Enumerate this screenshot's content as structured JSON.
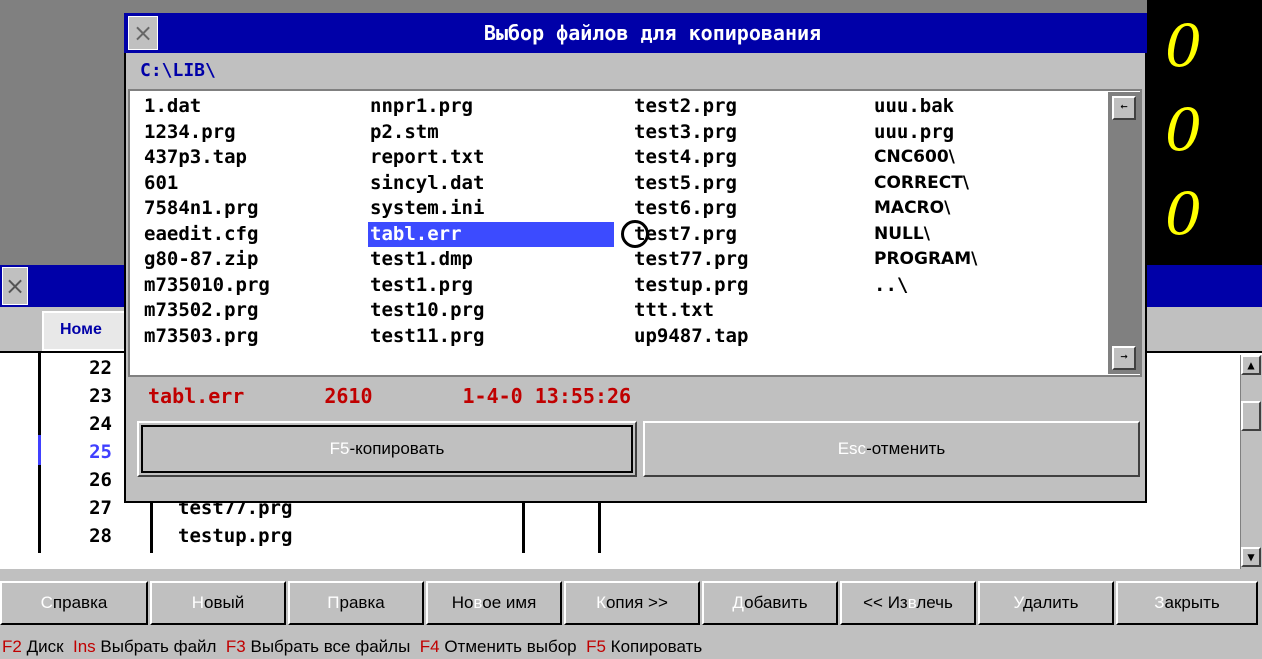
{
  "background": {
    "digits": [
      "0",
      "0",
      "0"
    ],
    "tab_label": "Номе",
    "rows": [
      {
        "num": "22",
        "name": ""
      },
      {
        "num": "23",
        "name": ""
      },
      {
        "num": "24",
        "name": ""
      },
      {
        "num": "25",
        "name": ""
      },
      {
        "num": "26",
        "name": ""
      },
      {
        "num": "27",
        "name": "test77.prg"
      },
      {
        "num": "28",
        "name": "testup.prg"
      }
    ]
  },
  "dialog": {
    "title": "Выбор файлов для копирования",
    "path": "C:\\LIB\\",
    "files": {
      "col1": [
        "1.dat",
        "1234.prg",
        "437p3.tap",
        "601",
        "7584n1.prg",
        "eaedit.cfg",
        "g80-87.zip",
        "m735010.prg",
        "m73502.prg",
        "m73503.prg"
      ],
      "col2": [
        "nnpr1.prg",
        "p2.stm",
        "report.txt",
        "sincyl.dat",
        "system.ini",
        "tabl.err",
        "test1.dmp",
        "test1.prg",
        "test10.prg",
        "test11.prg"
      ],
      "col3": [
        "test2.prg",
        "test3.prg",
        "test4.prg",
        "test5.prg",
        "test6.prg",
        "test7.prg",
        "test77.prg",
        "testup.prg",
        "ttt.txt",
        "up9487.tap"
      ],
      "col4": [
        "uuu.bak",
        "uuu.prg",
        "CNC600\\",
        "CORRECT\\",
        "MACRO\\",
        "NULL\\",
        "PROGRAM\\",
        "..\\"
      ]
    },
    "selected_file": "tabl.err",
    "info": {
      "name": "tabl.err",
      "size": "2610",
      "datetime": "1-4-0 13:55:26"
    },
    "buttons": {
      "copy_hotkey": "F5",
      "copy_label": "-копировать",
      "cancel_hotkey": "Esc",
      "cancel_label": "-отменить"
    }
  },
  "toolbar": [
    {
      "hk": "С",
      "rest": "правка"
    },
    {
      "hk": "Н",
      "rest": "овый"
    },
    {
      "hk": "П",
      "rest": "равка"
    },
    {
      "pre": "Но",
      "hk": "в",
      "rest": "ое имя"
    },
    {
      "hk": "К",
      "rest": "опия >>"
    },
    {
      "hk": "Д",
      "rest": "обавить"
    },
    {
      "pre": "<< Из",
      "hk": "в",
      "rest": "лечь"
    },
    {
      "hk": "У",
      "rest": "далить"
    },
    {
      "hk": "З",
      "rest": "акрыть"
    }
  ],
  "status_line": [
    {
      "key": "F2",
      "text": "Диск"
    },
    {
      "key": "Ins",
      "text": "Выбрать файл"
    },
    {
      "key": "F3",
      "text": "Выбрать все файлы"
    },
    {
      "key": "F4",
      "text": "Отменить выбор"
    },
    {
      "key": "F5",
      "text": "Копировать"
    }
  ]
}
